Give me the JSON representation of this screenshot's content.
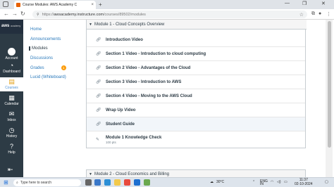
{
  "browser": {
    "tab_title": "Course Modules: AWS Academy C",
    "tab_close": "×",
    "new_tab": "+",
    "url_host": "awsacademy.instructure.com",
    "url_path": "/courses/89502/modules",
    "url_prefix": "https://"
  },
  "global_nav": {
    "logo_text": "aws",
    "logo_sub": "academy",
    "items": [
      {
        "label": "Account",
        "icon": "user-circle"
      },
      {
        "label": "Dashboard",
        "icon": "dashboard"
      },
      {
        "label": "Courses",
        "icon": "book"
      },
      {
        "label": "Calendar",
        "icon": "calendar"
      },
      {
        "label": "Inbox",
        "icon": "inbox"
      },
      {
        "label": "History",
        "icon": "clock"
      },
      {
        "label": "Help",
        "icon": "question"
      }
    ],
    "collapse_icon": "collapse-arrow"
  },
  "course_nav": {
    "items": [
      {
        "label": "Home"
      },
      {
        "label": "Announcements"
      },
      {
        "label": "Modules"
      },
      {
        "label": "Discussions"
      },
      {
        "label": "Grades",
        "badge": "1"
      },
      {
        "label": "Lucid (Whiteboard)"
      }
    ]
  },
  "module1": {
    "title": "Module 1 - Cloud Concepts Overview",
    "items": [
      {
        "title": "Introduction Video",
        "icon": "link"
      },
      {
        "title": "Section 1 Video - Introduction to cloud computing",
        "icon": "link"
      },
      {
        "title": "Section 2 Video - Advantages of the Cloud",
        "icon": "link"
      },
      {
        "title": "Section 3 Video - Introduction to AWS",
        "icon": "link"
      },
      {
        "title": "Section 4 Video - Moving to the AWS Cloud",
        "icon": "link"
      },
      {
        "title": "Wrap Up Video",
        "icon": "link"
      },
      {
        "title": "Student Guide",
        "icon": "link"
      },
      {
        "title": "Module 1 Knowledge Check",
        "sub": "100 pts",
        "icon": "quiz"
      }
    ]
  },
  "module2": {
    "title": "Module 2 - Cloud Economics and Billing"
  },
  "taskbar": {
    "search_placeholder": "Type here to search",
    "weather": "30°C",
    "lang": "ENG",
    "lang_sub": "IN",
    "time": "11:37",
    "date": "02-10-2024"
  }
}
